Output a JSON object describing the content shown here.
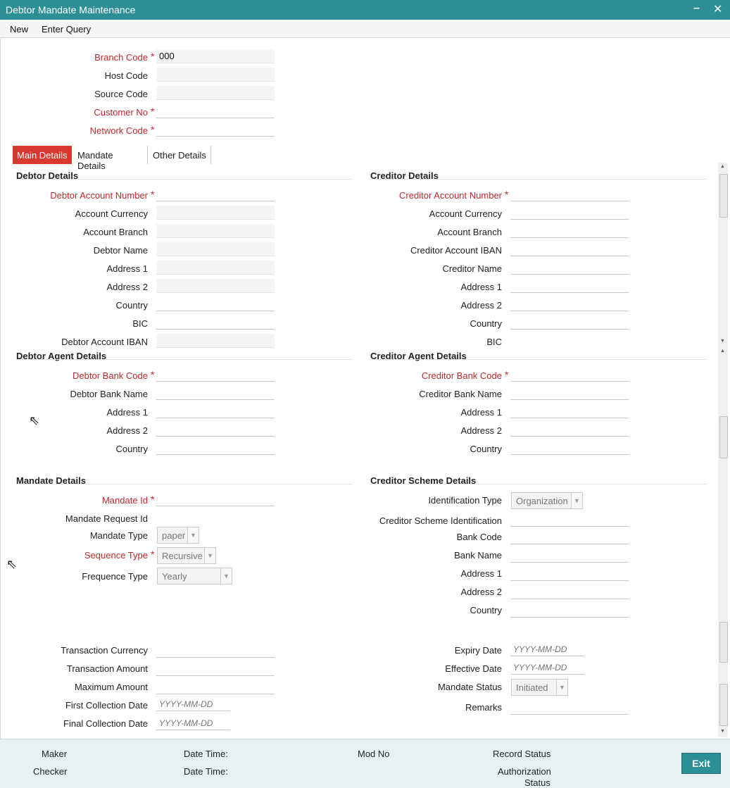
{
  "window": {
    "title": "Debtor Mandate Maintenance",
    "minimize": "–",
    "close": "✕"
  },
  "menu": {
    "new": "New",
    "enter_query": "Enter Query"
  },
  "header": {
    "branch_code_label": "Branch Code",
    "branch_code_value": "000",
    "host_code_label": "Host Code",
    "source_code_label": "Source Code",
    "customer_no_label": "Customer No",
    "network_code_label": "Network Code"
  },
  "tabs": [
    "Main Details",
    "Mandate Details",
    "Other Details"
  ],
  "debtor": {
    "title": "Debtor Details",
    "account_number": "Debtor Account Number",
    "account_currency": "Account Currency",
    "account_branch": "Account Branch",
    "name": "Debtor Name",
    "address1": "Address 1",
    "address2": "Address 2",
    "country": "Country",
    "bic": "BIC",
    "iban": "Debtor Account IBAN"
  },
  "creditor": {
    "title": "Creditor Details",
    "account_number": "Creditor Account Number",
    "account_currency": "Account Currency",
    "account_branch": "Account Branch",
    "iban": "Creditor Account IBAN",
    "name": "Creditor Name",
    "address1": "Address 1",
    "address2": "Address 2",
    "country": "Country",
    "bic": "BIC"
  },
  "debtor_agent": {
    "title": "Debtor Agent Details",
    "bank_code": "Debtor Bank Code",
    "bank_name": "Debtor Bank Name",
    "address1": "Address 1",
    "address2": "Address 2",
    "country": "Country"
  },
  "creditor_agent": {
    "title": "Creditor Agent Details",
    "bank_code": "Creditor Bank Code",
    "bank_name": "Creditor Bank Name",
    "address1": "Address 1",
    "address2": "Address 2",
    "country": "Country"
  },
  "mandate": {
    "title": "Mandate Details",
    "mandate_id": "Mandate Id",
    "request_id": "Mandate Request Id",
    "type_label": "Mandate Type",
    "type_value": "paper",
    "sequence_label": "Sequence Type",
    "sequence_value": "Recursive",
    "frequence_label": "Frequence Type",
    "frequence_value": "Yearly"
  },
  "scheme": {
    "title": "Creditor Scheme Details",
    "id_type_label": "Identification Type",
    "id_type_value": "Organization",
    "scheme_id": "Creditor Scheme Identification",
    "bank_code": "Bank Code",
    "bank_name": "Bank Name",
    "address1": "Address 1",
    "address2": "Address 2",
    "country": "Country"
  },
  "txn": {
    "currency": "Transaction Currency",
    "amount": "Transaction Amount",
    "max_amount": "Maximum Amount",
    "first_date": "First Collection Date",
    "final_date": "Final Collection Date",
    "expiry_date": "Expiry Date",
    "effective_date": "Effective Date",
    "status_label": "Mandate Status",
    "status_value": "Initiated",
    "remarks": "Remarks",
    "date_placeholder": "YYYY-MM-DD"
  },
  "footer": {
    "maker": "Maker",
    "checker": "Checker",
    "date_time": "Date Time:",
    "date_time2": "Date Time:",
    "mod_no": "Mod No",
    "record_status": "Record Status",
    "auth_status_1": "Authorization",
    "auth_status_2": "Status",
    "exit": "Exit"
  }
}
